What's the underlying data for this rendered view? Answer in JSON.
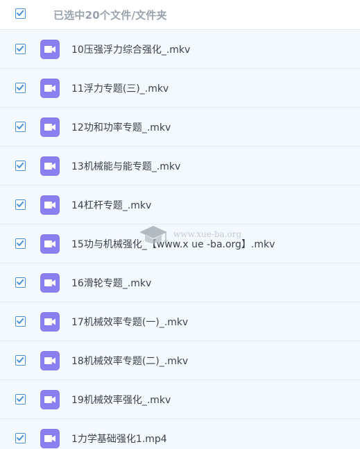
{
  "header": {
    "selected_label": "已选中20个文件/文件夹",
    "checked": true
  },
  "files": [
    {
      "name": "10压强浮力综合强化_.mkv",
      "checked": true,
      "icon": "video-file-icon"
    },
    {
      "name": "11浮力专题(三)_.mkv",
      "checked": true,
      "icon": "video-file-icon"
    },
    {
      "name": "12功和功率专题_.mkv",
      "checked": true,
      "icon": "video-file-icon"
    },
    {
      "name": "13机械能与能专题_.mkv",
      "checked": true,
      "icon": "video-file-icon"
    },
    {
      "name": "14杠杆专题_.mkv",
      "checked": true,
      "icon": "video-file-icon"
    },
    {
      "name": "15功与机械强化_【www.x ue -ba.org】.mkv",
      "checked": true,
      "icon": "video-file-icon"
    },
    {
      "name": "16滑轮专题_.mkv",
      "checked": true,
      "icon": "video-file-icon"
    },
    {
      "name": "17机械效率专题(一)_.mkv",
      "checked": true,
      "icon": "video-file-icon"
    },
    {
      "name": "18机械效率专题(二)_.mkv",
      "checked": true,
      "icon": "video-file-icon"
    },
    {
      "name": "19机械效率强化_.mkv",
      "checked": true,
      "icon": "video-file-icon"
    },
    {
      "name": "1力学基础强化1.mp4",
      "checked": true,
      "icon": "video-file-icon"
    }
  ],
  "watermark": {
    "text": "www.xue-ba.org",
    "icon": "graduation-cap-icon"
  },
  "colors": {
    "accent": "#4a8fd6",
    "file_icon": "#8b7ef0",
    "row_bg": "#f4f9fd",
    "header_text": "#9aa3ad"
  }
}
